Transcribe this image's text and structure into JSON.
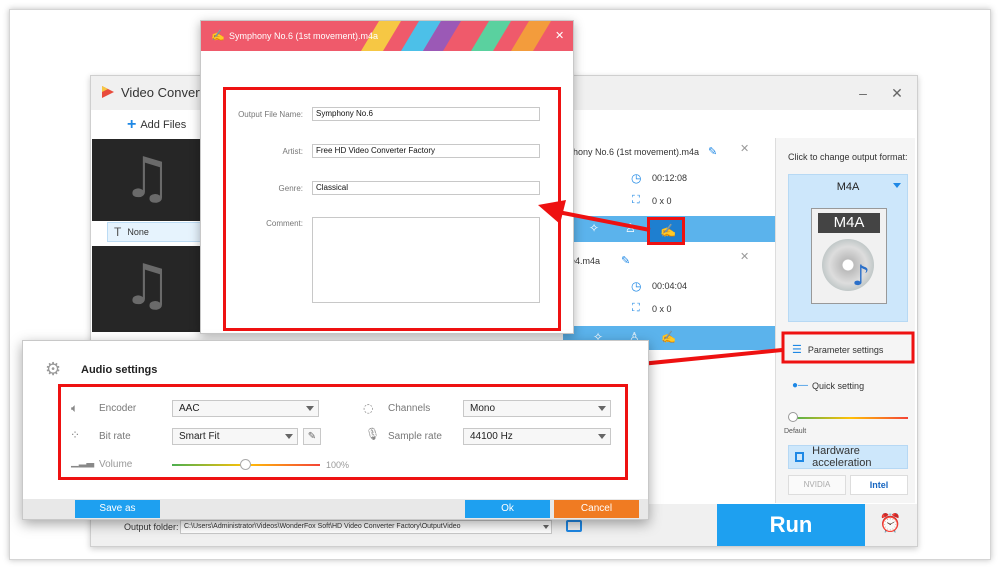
{
  "main_window": {
    "title": "Video Converter",
    "add_files_label": "Add Files",
    "subtitle_none": "None",
    "file1": {
      "name": "nphony No.6 (1st movement).m4a",
      "duration": "00:12:08",
      "resolution": "0 x 0"
    },
    "file2": {
      "name": "ble4.m4a",
      "duration": "00:04:04",
      "resolution": "0 x 0"
    },
    "output_format_hint": "Click to change output format:",
    "format_name": "M4A",
    "format_badge": "M4A",
    "parameter_settings_label": "Parameter settings",
    "quick_setting_label": "Quick setting",
    "default_label": "Default",
    "hardware_accel_label": "Hardware acceleration",
    "nvidia_label": "NVIDIA",
    "intel_label": "Intel",
    "output_folder_label": "Output folder:",
    "output_folder_path": "C:\\Users\\Administrator\\Videos\\WonderFox Soft\\HD Video Converter Factory\\OutputVideo",
    "run_label": "Run",
    "minimize_glyph": "–",
    "close_glyph": "✕"
  },
  "tag_dialog": {
    "title": "Symphony No.6 (1st movement).m4a",
    "fields": {
      "output_file_name_label": "Output File Name:",
      "output_file_name_value": "Symphony No.6",
      "artist_label": "Artist:",
      "artist_value": "Free HD Video Converter Factory",
      "genre_label": "Genre:",
      "genre_value": "Classical",
      "comment_label": "Comment:",
      "comment_value": ""
    },
    "stripe_colors": [
      "#f6c744",
      "#4cc0e8",
      "#9b59b6",
      "#5ad19f",
      "#f39c3c",
      "#e84b6a"
    ]
  },
  "audio_dialog": {
    "title": "Audio settings",
    "encoder_label": "Encoder",
    "encoder_value": "AAC",
    "bitrate_label": "Bit rate",
    "bitrate_value": "Smart Fit",
    "volume_label": "Volume",
    "volume_value": "100%",
    "volume_level": 0.5,
    "channels_label": "Channels",
    "channels_value": "Mono",
    "sample_rate_label": "Sample rate",
    "sample_rate_value": "44100 Hz",
    "save_as_label": "Save as",
    "ok_label": "Ok",
    "cancel_label": "Cancel"
  },
  "colors": {
    "accent_blue": "#1ea0f0",
    "highlight_red": "#e11111",
    "cancel_orange": "#f07b22",
    "tag_title_bg": "#ef5a6b"
  }
}
